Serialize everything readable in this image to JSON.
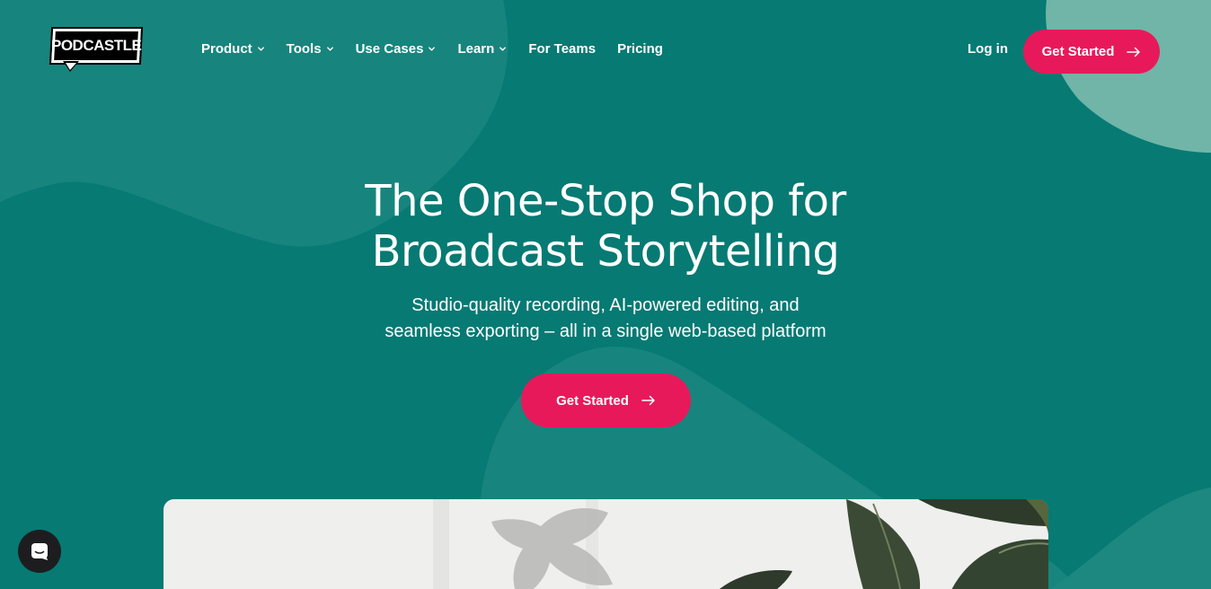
{
  "colors": {
    "background": "#067a73",
    "accent": "#e8195a",
    "text": "#ffffff"
  },
  "header": {
    "logo_text": "PODCASTLE",
    "nav": [
      {
        "label": "Product",
        "has_dropdown": true
      },
      {
        "label": "Tools",
        "has_dropdown": true
      },
      {
        "label": "Use Cases",
        "has_dropdown": true
      },
      {
        "label": "Learn",
        "has_dropdown": true
      },
      {
        "label": "For Teams",
        "has_dropdown": false
      },
      {
        "label": "Pricing",
        "has_dropdown": false
      }
    ],
    "login_label": "Log in",
    "cta_label": "Get Started"
  },
  "hero": {
    "title_line1": "The One-Stop Shop for",
    "title_line2": "Broadcast Storytelling",
    "subtitle_line1": "Studio-quality recording, AI-powered editing, and",
    "subtitle_line2": "seamless exporting – all in a single web-based platform",
    "cta_label": "Get Started"
  },
  "icons": {
    "nav_dropdown": "chevron-down-icon",
    "cta": "arrow-right-icon",
    "chat": "chat-icon"
  }
}
